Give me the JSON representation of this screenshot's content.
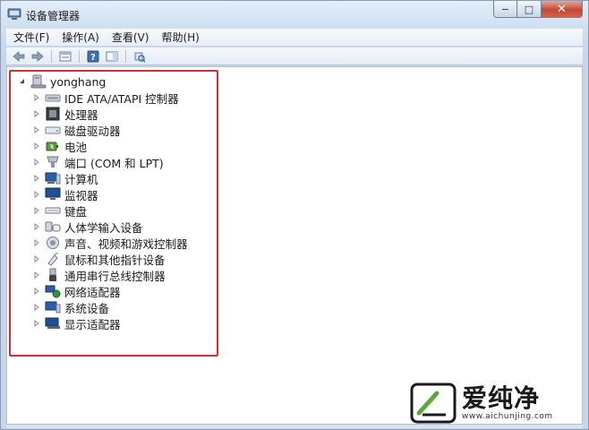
{
  "window": {
    "title": "设备管理器",
    "icon": "device-manager-icon",
    "caption_buttons": {
      "minimize": "−",
      "maximize": "□",
      "close": "✕"
    }
  },
  "menu": {
    "items": [
      "文件(F)",
      "操作(A)",
      "查看(V)",
      "帮助(H)"
    ]
  },
  "toolbar": {
    "buttons": [
      "back-arrow-icon",
      "forward-arrow-icon",
      "properties-view-icon",
      "help-icon",
      "action-pane-icon",
      "scan-hardware-icon"
    ]
  },
  "tree": {
    "root": {
      "label": "yonghang",
      "icon": "computer-icon",
      "expanded": true
    },
    "children": [
      {
        "label": "IDE ATA/ATAPI 控制器",
        "icon": "ide-controller-icon"
      },
      {
        "label": "处理器",
        "icon": "processor-icon"
      },
      {
        "label": "磁盘驱动器",
        "icon": "disk-drive-icon"
      },
      {
        "label": "电池",
        "icon": "battery-icon"
      },
      {
        "label": "端口 (COM 和 LPT)",
        "icon": "port-icon"
      },
      {
        "label": "计算机",
        "icon": "computer-icon"
      },
      {
        "label": "监视器",
        "icon": "monitor-icon"
      },
      {
        "label": "键盘",
        "icon": "keyboard-icon"
      },
      {
        "label": "人体学输入设备",
        "icon": "hid-icon"
      },
      {
        "label": "声音、视频和游戏控制器",
        "icon": "sound-icon"
      },
      {
        "label": "鼠标和其他指针设备",
        "icon": "mouse-icon"
      },
      {
        "label": "通用串行总线控制器",
        "icon": "usb-icon"
      },
      {
        "label": "网络适配器",
        "icon": "network-adapter-icon"
      },
      {
        "label": "系统设备",
        "icon": "system-device-icon"
      },
      {
        "label": "显示适配器",
        "icon": "display-adapter-icon"
      }
    ]
  },
  "watermark": {
    "brand": "爱纯净",
    "url": "www.aichunjing.com"
  },
  "colors": {
    "highlight_border": "#c8323c",
    "watermark_green": "#5aa83a"
  }
}
